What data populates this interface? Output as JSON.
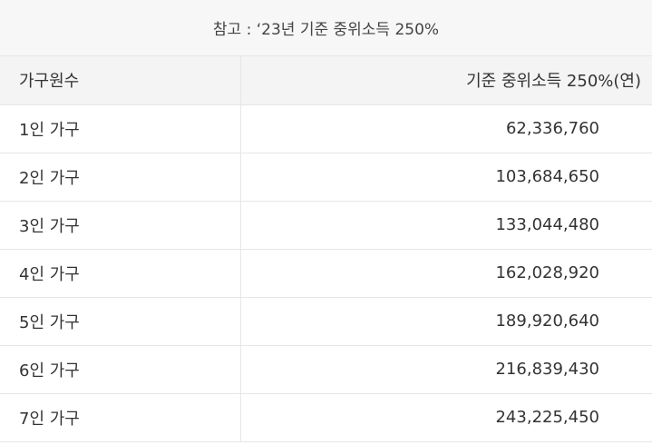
{
  "caption": "참고 : ‘23년 기준 중위소득 250%",
  "table": {
    "headers": [
      "가구원수",
      "기준 중위소득 250%(연)"
    ],
    "rows": [
      {
        "household": "1인 가구",
        "income": "62,336,760"
      },
      {
        "household": "2인 가구",
        "income": "103,684,650"
      },
      {
        "household": "3인 가구",
        "income": "133,044,480"
      },
      {
        "household": "4인 가구",
        "income": "162,028,920"
      },
      {
        "household": "5인 가구",
        "income": "189,920,640"
      },
      {
        "household": "6인 가구",
        "income": "216,839,430"
      },
      {
        "household": "7인 가구",
        "income": "243,225,450"
      }
    ]
  }
}
